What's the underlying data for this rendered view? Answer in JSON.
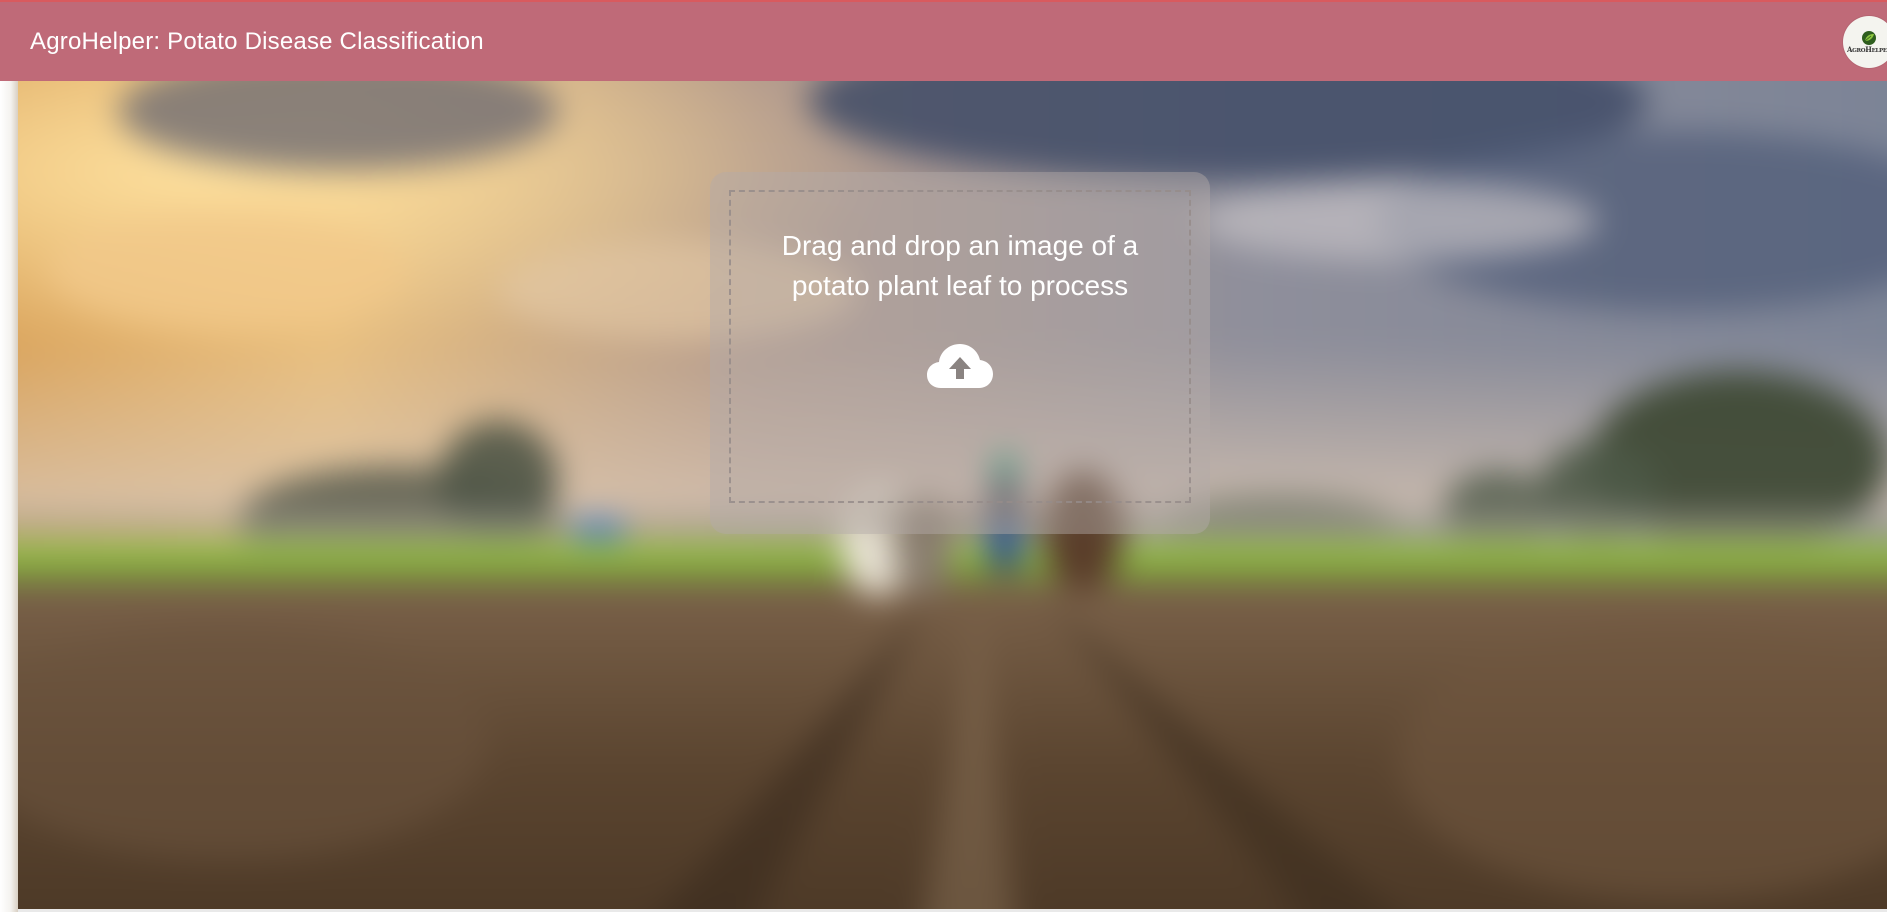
{
  "header": {
    "title": "AgroHelper: Potato Disease Classification",
    "background_color": "#bf6a78",
    "accent_border_color": "#d95a5e",
    "logo": {
      "icon": "leaf-logo-icon",
      "text": "AGROHELPER"
    }
  },
  "background": {
    "description_icon": "farm-field-background-image"
  },
  "uploader": {
    "prompt": "Drag and drop an image of a potato plant leaf to process",
    "icon": "cloud-upload-icon"
  }
}
